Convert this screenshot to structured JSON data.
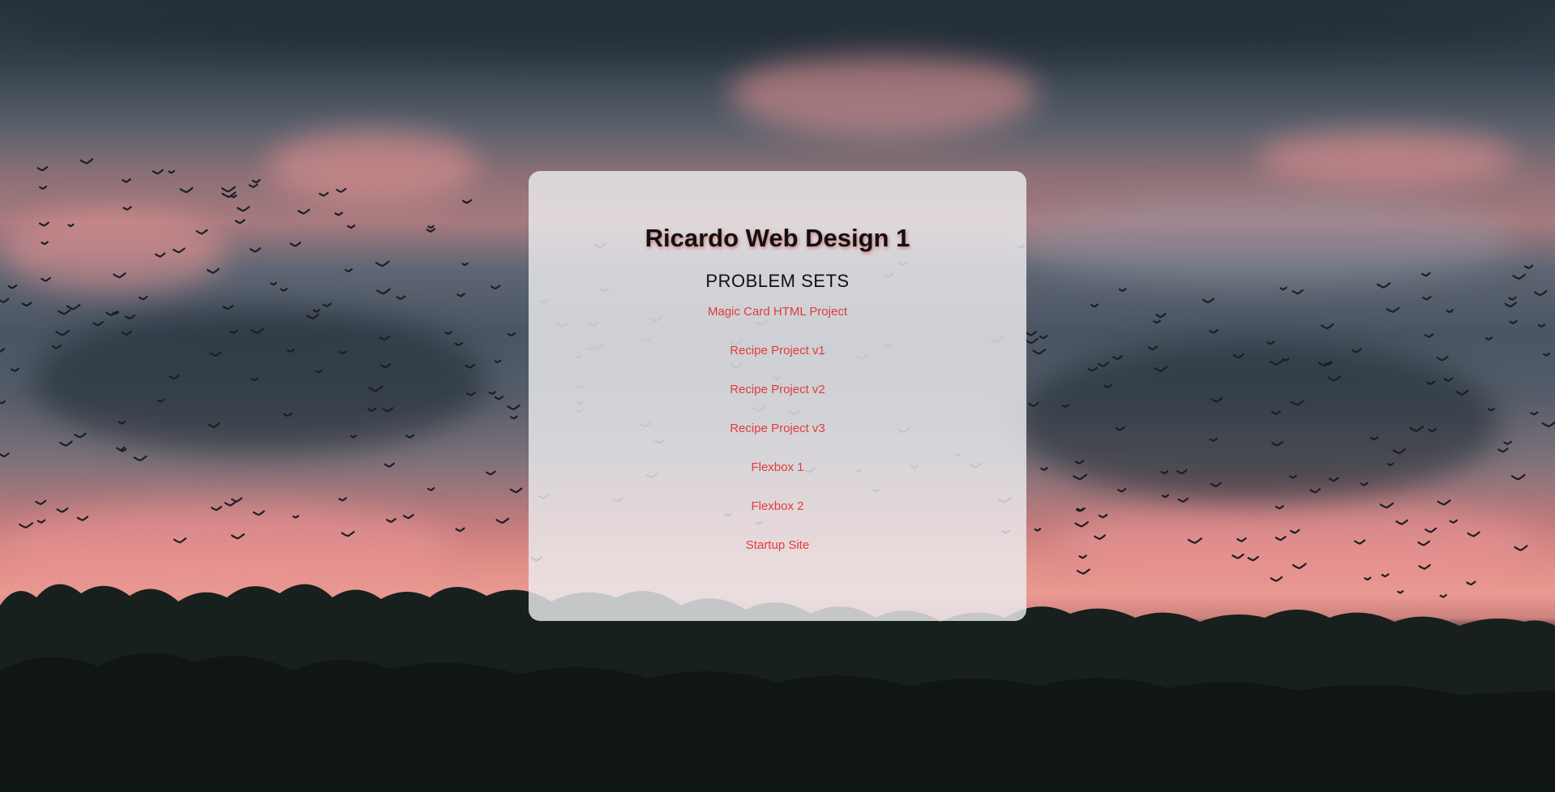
{
  "card": {
    "title": "Ricardo Web Design 1",
    "subtitle": "PROBLEM SETS",
    "links": [
      {
        "label": "Magic Card HTML Project"
      },
      {
        "label": "Recipe Project v1"
      },
      {
        "label": "Recipe Project v2"
      },
      {
        "label": "Recipe Project v3"
      },
      {
        "label": "Flexbox 1"
      },
      {
        "label": "Flexbox 2"
      },
      {
        "label": "Startup Site"
      }
    ]
  },
  "colors": {
    "link": "#e33b3b",
    "heading": "#111111",
    "card_background": "rgba(236,236,238,0.82)"
  },
  "background": {
    "icon": "sunset-sky-birds-photo"
  }
}
